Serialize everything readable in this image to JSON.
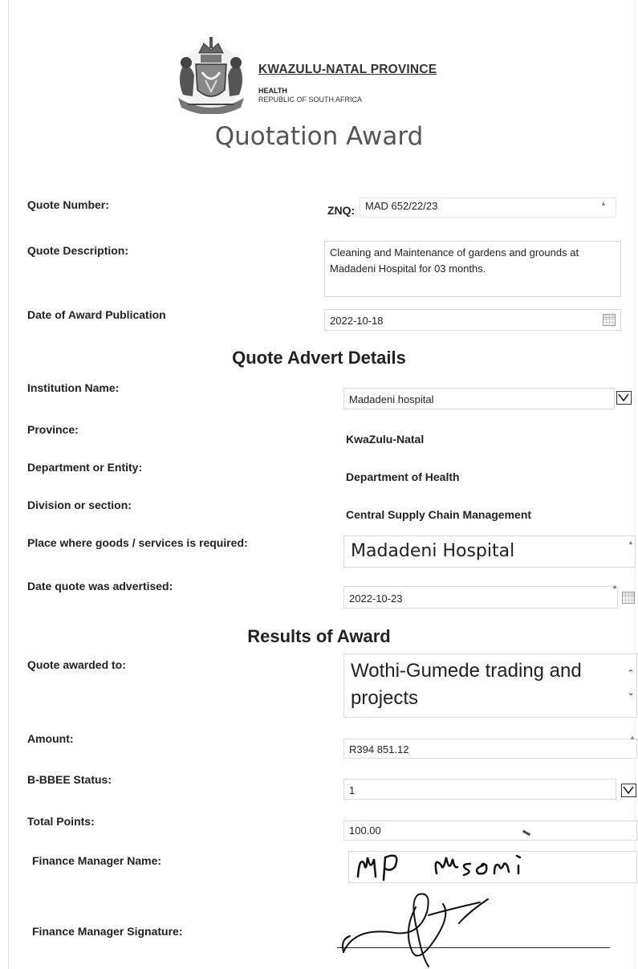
{
  "header": {
    "province": "KWAZULU-NATAL PROVINCE",
    "department": "HEALTH",
    "country": "REPUBLIC OF SOUTH AFRICA"
  },
  "title": "Quotation Award",
  "award": {
    "quote_number_label": "Quote Number:",
    "quote_number_prefix": "ZNQ:",
    "quote_number": "MAD 652/22/23",
    "quote_description_label": "Quote Description:",
    "quote_description": "Cleaning and Maintenance of gardens and grounds at Madadeni Hospital for 03 months.",
    "date_publication_label": "Date of Award Publication",
    "date_publication": "2022-10-18"
  },
  "advert": {
    "heading": "Quote Advert Details",
    "institution_label": "Institution Name:",
    "institution": "Madadeni hospital",
    "province_label": "Province:",
    "province": "KwaZulu-Natal",
    "department_label": "Department or Entity:",
    "department": "Department of Health",
    "division_label": "Division or section:",
    "division": "Central Supply Chain Management",
    "place_label": "Place where goods /  services is required:",
    "place": "Madadeni Hospital",
    "date_advertised_label": "Date quote was advertised:",
    "date_advertised": "2022-10-23"
  },
  "results": {
    "heading": "Results of Award",
    "awarded_to_label": "Quote awarded to:",
    "awarded_to": "Wothi-Gumede trading and projects",
    "amount_label": "Amount:",
    "amount": "R394 851.12",
    "bbbee_label": "B-BBEE Status:",
    "bbbee": "1",
    "total_points_label": "Total Points:",
    "total_points": "100.00",
    "finance_manager_name_label": "Finance Manager Name:",
    "finance_manager_name": "MP Msomi",
    "finance_manager_signature_label": "Finance Manager Signature:"
  },
  "icons": {
    "crest": "coat-of-arms-icon",
    "calendar": "calendar-icon",
    "dropdown": "dropdown-arrow-icon"
  }
}
